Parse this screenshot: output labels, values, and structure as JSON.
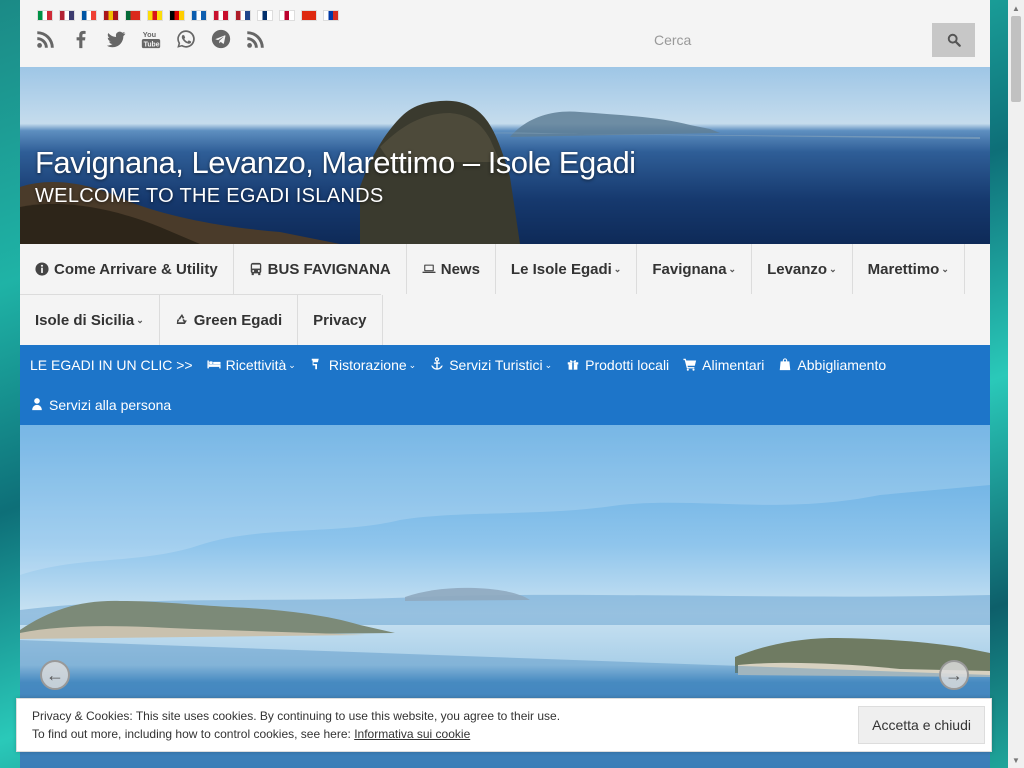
{
  "flags": [
    {
      "lang": "it",
      "colors": [
        "#009246",
        "#ffffff",
        "#ce2b37"
      ]
    },
    {
      "lang": "en-us",
      "colors": [
        "#b22234",
        "#ffffff",
        "#3c3b6e"
      ]
    },
    {
      "lang": "fr",
      "colors": [
        "#0055a4",
        "#ffffff",
        "#ef4135"
      ]
    },
    {
      "lang": "es",
      "colors": [
        "#aa151b",
        "#f1bf00",
        "#aa151b"
      ]
    },
    {
      "lang": "pt",
      "colors": [
        "#046a38",
        "#da291c",
        "#da291c"
      ]
    },
    {
      "lang": "ca",
      "colors": [
        "#fcdd09",
        "#da121a",
        "#fcdd09"
      ]
    },
    {
      "lang": "de",
      "colors": [
        "#000000",
        "#dd0000",
        "#ffce00"
      ]
    },
    {
      "lang": "el",
      "colors": [
        "#0d5eaf",
        "#ffffff",
        "#0d5eaf"
      ]
    },
    {
      "lang": "da",
      "colors": [
        "#c8102e",
        "#ffffff",
        "#c8102e"
      ]
    },
    {
      "lang": "nl",
      "colors": [
        "#ae1c28",
        "#ffffff",
        "#21468b"
      ]
    },
    {
      "lang": "fi",
      "colors": [
        "#ffffff",
        "#002f6c",
        "#ffffff"
      ]
    },
    {
      "lang": "ja",
      "colors": [
        "#ffffff",
        "#bc002d",
        "#ffffff"
      ]
    },
    {
      "lang": "zh",
      "colors": [
        "#de2910",
        "#de2910",
        "#de2910"
      ]
    },
    {
      "lang": "ru",
      "colors": [
        "#ffffff",
        "#0039a6",
        "#d52b1e"
      ]
    }
  ],
  "social": [
    "rss-icon",
    "facebook-icon",
    "twitter-icon",
    "youtube-icon",
    "whatsapp-icon",
    "telegram-icon",
    "rss-icon"
  ],
  "search": {
    "placeholder": "Cerca"
  },
  "header": {
    "title": "Favignana, Levanzo, Marettimo – Isole Egadi",
    "tagline": "WELCOME TO THE EGADI ISLANDS"
  },
  "main_nav": {
    "row1": [
      {
        "label": "Come Arrivare & Utility",
        "icon": "info-icon",
        "dropdown": false
      },
      {
        "label": "BUS FAVIGNANA",
        "icon": "bus-icon",
        "dropdown": false
      },
      {
        "label": "News",
        "icon": "laptop-icon",
        "dropdown": false
      },
      {
        "label": "Le Isole Egadi",
        "icon": "",
        "dropdown": true
      },
      {
        "label": "Favignana",
        "icon": "",
        "dropdown": true
      },
      {
        "label": "Levanzo",
        "icon": "",
        "dropdown": true
      },
      {
        "label": "Marettimo",
        "icon": "",
        "dropdown": true
      }
    ],
    "row2": [
      {
        "label": "Isole di Sicilia",
        "icon": "",
        "dropdown": true
      },
      {
        "label": "Green Egadi",
        "icon": "recycle-icon",
        "dropdown": false
      },
      {
        "label": "Privacy",
        "icon": "",
        "dropdown": false
      }
    ]
  },
  "sub_nav": {
    "row1": [
      {
        "label": "LE EGADI IN UN CLIC >>",
        "icon": "",
        "dropdown": false
      },
      {
        "label": "Ricettività",
        "icon": "bed-icon",
        "dropdown": true
      },
      {
        "label": "Ristorazione",
        "icon": "cutlery-icon",
        "dropdown": true
      },
      {
        "label": "Servizi Turistici",
        "icon": "anchor-icon",
        "dropdown": true
      },
      {
        "label": "Prodotti locali",
        "icon": "gift-icon",
        "dropdown": false
      },
      {
        "label": "Alimentari",
        "icon": "cart-icon",
        "dropdown": false
      },
      {
        "label": "Abbigliamento",
        "icon": "bag-icon",
        "dropdown": false
      }
    ],
    "row2": [
      {
        "label": "Servizi alla persona",
        "icon": "user-icon",
        "dropdown": false
      }
    ]
  },
  "slider": {
    "prev_label": "←",
    "next_label": "→"
  },
  "cookie": {
    "line1": "Privacy & Cookies: This site uses cookies. By continuing to use this website, you agree to their use.",
    "line2_prefix": "To find out more, including how to control cookies, see here: ",
    "link": "Informativa sui cookie",
    "accept": "Accetta e chiudi"
  },
  "colors": {
    "subnav_bg": "#1d75c9",
    "page_bg": "#f4f4f4"
  }
}
